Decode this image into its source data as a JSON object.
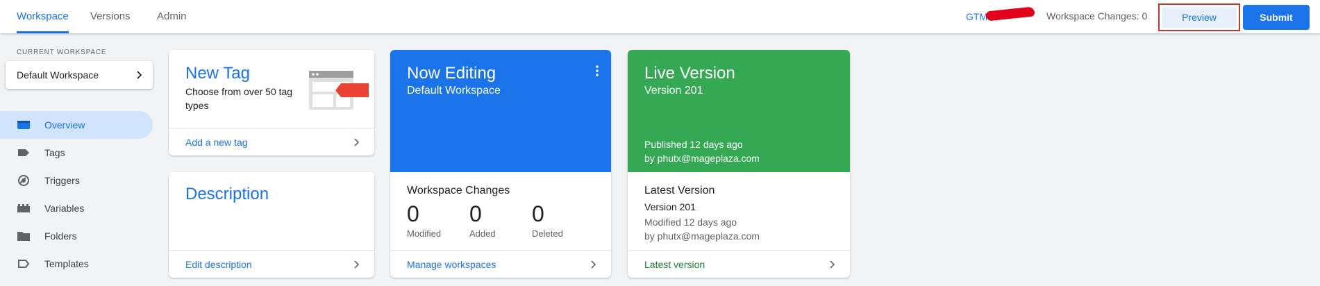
{
  "colors": {
    "accent": "#1a73e8",
    "editing_bg": "#1a73e8",
    "live_bg": "#34a853",
    "live_link": "#188038",
    "preview_outline": "#c0392b",
    "redaction": "#e3001b"
  },
  "header": {
    "tabs": [
      {
        "label": "Workspace",
        "active": true
      },
      {
        "label": "Versions",
        "active": false
      },
      {
        "label": "Admin",
        "active": false
      }
    ],
    "container_id": "GTM",
    "workspace_changes": "Workspace Changes: 0",
    "preview_label": "Preview",
    "submit_label": "Submit"
  },
  "sidebar": {
    "current_workspace_label": "CURRENT WORKSPACE",
    "workspace_name": "Default Workspace",
    "items": [
      {
        "label": "Overview",
        "icon": "overview-icon",
        "active": true
      },
      {
        "label": "Tags",
        "icon": "tag-icon",
        "active": false
      },
      {
        "label": "Triggers",
        "icon": "trigger-icon",
        "active": false
      },
      {
        "label": "Variables",
        "icon": "variables-icon",
        "active": false
      },
      {
        "label": "Folders",
        "icon": "folder-icon",
        "active": false
      },
      {
        "label": "Templates",
        "icon": "template-icon",
        "active": false
      }
    ]
  },
  "new_tag": {
    "title": "New Tag",
    "subtitle": "Choose from over 50 tag types",
    "link": "Add a new tag"
  },
  "description": {
    "title": "Description",
    "link": "Edit description"
  },
  "now_editing": {
    "title": "Now Editing",
    "workspace": "Default Workspace",
    "changes_title": "Workspace Changes",
    "stats": [
      {
        "value": "0",
        "label": "Modified"
      },
      {
        "value": "0",
        "label": "Added"
      },
      {
        "value": "0",
        "label": "Deleted"
      }
    ],
    "link": "Manage workspaces"
  },
  "live_version": {
    "title": "Live Version",
    "version": "Version 201",
    "published": "Published 12 days ago",
    "published_by": "by phutx@mageplaza.com",
    "latest_title": "Latest Version",
    "latest_version": "Version 201",
    "latest_modified": "Modified 12 days ago",
    "latest_by": "by phutx@mageplaza.com",
    "link": "Latest version"
  }
}
